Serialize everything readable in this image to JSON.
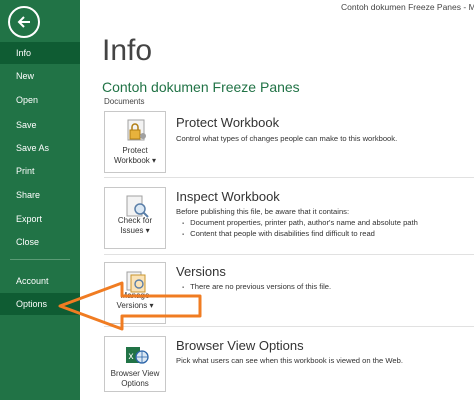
{
  "window": {
    "title": "Contoh dokumen Freeze Panes - Micros"
  },
  "sidebar": {
    "items": [
      {
        "label": "Info",
        "active": true
      },
      {
        "label": "New"
      },
      {
        "label": "Open"
      },
      {
        "label": "Save"
      },
      {
        "label": "Save As"
      },
      {
        "label": "Print"
      },
      {
        "label": "Share"
      },
      {
        "label": "Export"
      },
      {
        "label": "Close"
      },
      {
        "label": "Account"
      },
      {
        "label": "Options"
      }
    ]
  },
  "main": {
    "title": "Info",
    "workbook_name": "Contoh dokumen Freeze Panes",
    "location": "Documents",
    "sections": [
      {
        "tile_label": "Protect Workbook",
        "tile_label_lines": [
          "Protect",
          "Workbook ▾"
        ],
        "title": "Protect Workbook",
        "desc": "Control what types of changes people can make to this workbook."
      },
      {
        "tile_label_lines": [
          "Check for",
          "Issues ▾"
        ],
        "title": "Inspect Workbook",
        "desc": "Before publishing this file, be aware that it contains:",
        "bullets": [
          "Document properties, printer path, author's name and absolute path",
          "Content that people with disabilities find difficult to read"
        ]
      },
      {
        "tile_label_lines": [
          "Manage",
          "Versions ▾"
        ],
        "title": "Versions",
        "bullets": [
          "There are no previous versions of this file."
        ]
      },
      {
        "tile_label_lines": [
          "Browser View",
          "Options"
        ],
        "title": "Browser View Options",
        "desc": "Pick what users can see when this workbook is viewed on the Web."
      }
    ]
  },
  "colors": {
    "accent": "#217346",
    "sidebar_active": "#0f5c33",
    "annotation_arrow": "#f07c22"
  }
}
